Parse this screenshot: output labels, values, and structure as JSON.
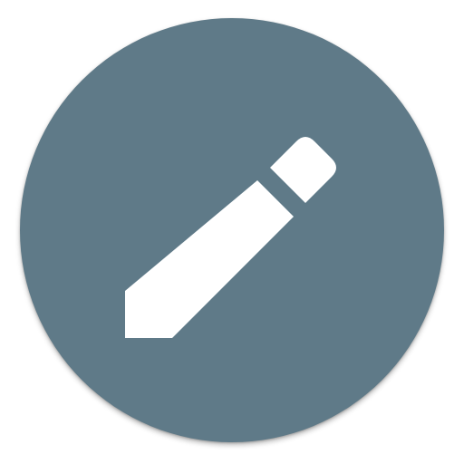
{
  "app_icon": {
    "icon_name": "pencil-icon",
    "background_color": "#5f7a88",
    "glyph_color": "#ffffff"
  }
}
